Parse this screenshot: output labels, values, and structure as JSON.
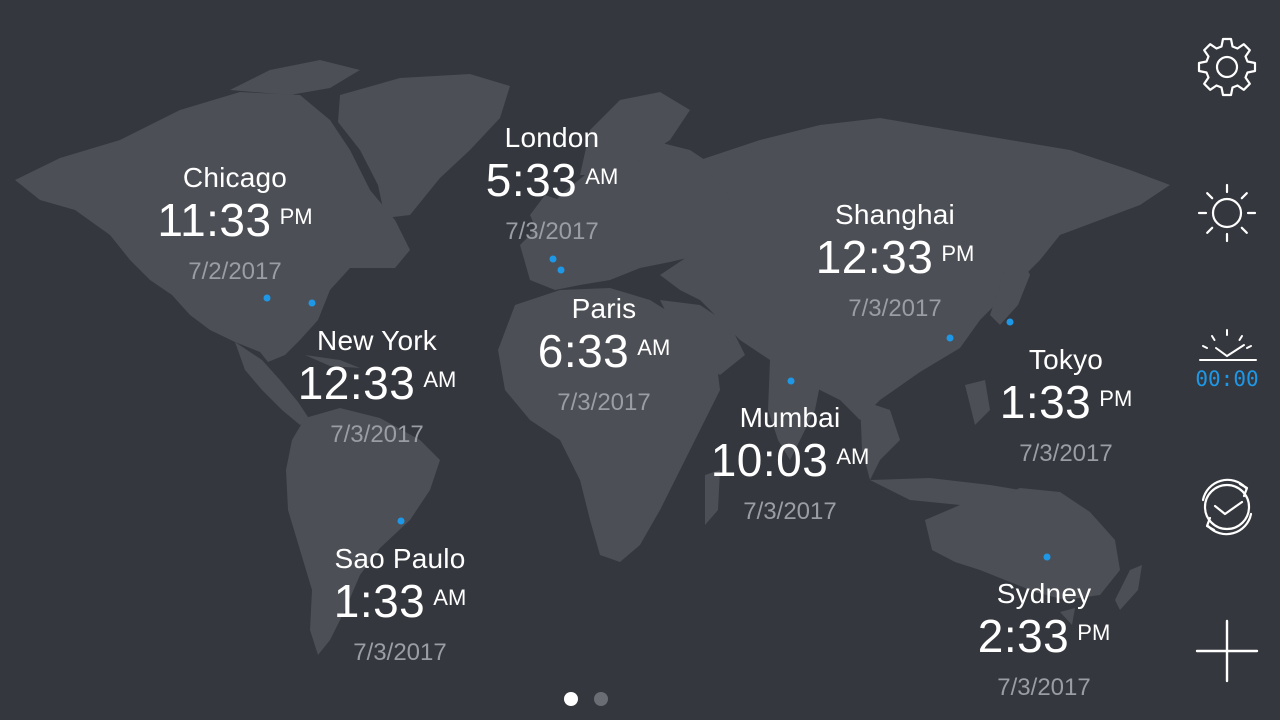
{
  "cities": [
    {
      "id": "chicago",
      "name": "Chicago",
      "time": "11:33",
      "ampm": "PM",
      "date": "7/2/2017"
    },
    {
      "id": "london",
      "name": "London",
      "time": "5:33",
      "ampm": "AM",
      "date": "7/3/2017"
    },
    {
      "id": "shanghai",
      "name": "Shanghai",
      "time": "12:33",
      "ampm": "PM",
      "date": "7/3/2017"
    },
    {
      "id": "new-york",
      "name": "New York",
      "time": "12:33",
      "ampm": "AM",
      "date": "7/3/2017"
    },
    {
      "id": "paris",
      "name": "Paris",
      "time": "6:33",
      "ampm": "AM",
      "date": "7/3/2017"
    },
    {
      "id": "tokyo",
      "name": "Tokyo",
      "time": "1:33",
      "ampm": "PM",
      "date": "7/3/2017"
    },
    {
      "id": "mumbai",
      "name": "Mumbai",
      "time": "10:03",
      "ampm": "AM",
      "date": "7/3/2017"
    },
    {
      "id": "sao-paulo",
      "name": "Sao Paulo",
      "time": "1:33",
      "ampm": "AM",
      "date": "7/3/2017"
    },
    {
      "id": "sydney",
      "name": "Sydney",
      "time": "2:33",
      "ampm": "PM",
      "date": "7/3/2017"
    }
  ],
  "toolbar": {
    "buttons": [
      {
        "id": "settings",
        "icon": "gear-icon"
      },
      {
        "id": "brightness",
        "icon": "sun-icon"
      },
      {
        "id": "alarm-clock",
        "icon": "alarm-clock-icon",
        "digital_text": "00:00"
      },
      {
        "id": "time-travel",
        "icon": "rotating-clock-icon"
      },
      {
        "id": "add-city",
        "icon": "plus-icon"
      }
    ]
  },
  "pager": {
    "pages": 2,
    "active": 0
  },
  "colors": {
    "background": "#34373d",
    "land": "#4c4f55",
    "dot": "#1e98e6",
    "accent_blue": "#1e98e6",
    "date_text": "#9a9da3"
  }
}
